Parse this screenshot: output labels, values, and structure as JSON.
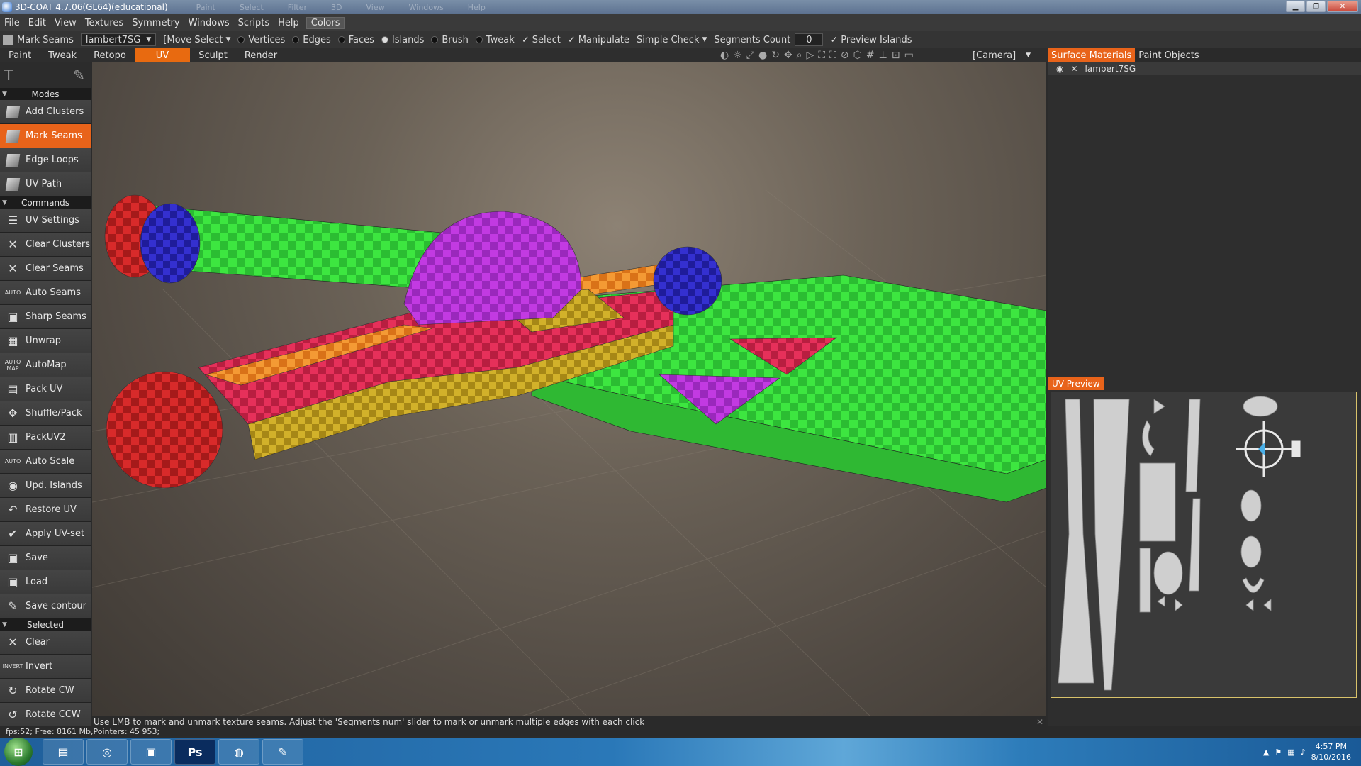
{
  "title": "3D-COAT 4.7.06(GL64)(educational)",
  "ghost_menu": [
    "Paint",
    "Select",
    "Filter",
    "3D",
    "View",
    "Windows",
    "Help"
  ],
  "menu": [
    "File",
    "Edit",
    "View",
    "Textures",
    "Symmetry",
    "Windows",
    "Scripts",
    "Help",
    "Colors"
  ],
  "options": {
    "tool_name": "Mark Seams",
    "material": "lambert7SG",
    "move_select": "[Move Select",
    "vertices": "Vertices",
    "edges": "Edges",
    "faces": "Faces",
    "islands": "Islands",
    "brush": "Brush",
    "tweak": "Tweak",
    "select": "Select",
    "manipulate": "Manipulate",
    "simple_check": "Simple Check",
    "segments_count": "Segments Count",
    "segments_value": "0",
    "preview_islands": "Preview Islands"
  },
  "rooms": [
    "Paint",
    "Tweak",
    "Retopo",
    "UV",
    "Sculpt",
    "Render"
  ],
  "active_room": "UV",
  "camera_label": "[Camera]",
  "sections": {
    "modes": "Modes",
    "commands": "Commands",
    "selected": "Selected"
  },
  "modes": [
    {
      "label": "Add Clusters",
      "icon": "cube-icon"
    },
    {
      "label": "Mark Seams",
      "icon": "cube-icon",
      "active": true
    },
    {
      "label": "Edge Loops",
      "icon": "cube-icon"
    },
    {
      "label": "UV Path",
      "icon": "cube-icon"
    }
  ],
  "commands": [
    {
      "label": "UV Settings",
      "icon": "sliders-icon",
      "glyph": "☰"
    },
    {
      "label": "Clear Clusters",
      "icon": "x-icon",
      "glyph": "✕"
    },
    {
      "label": "Clear Seams",
      "icon": "x-icon",
      "glyph": "✕"
    },
    {
      "label": "Auto Seams",
      "icon": "auto-icon",
      "glyph": "AUTO"
    },
    {
      "label": "Sharp Seams",
      "icon": "cube-icon",
      "glyph": "▣"
    },
    {
      "label": "Unwrap",
      "icon": "grid-icon",
      "glyph": "▦"
    },
    {
      "label": "AutoMap",
      "icon": "automap-icon",
      "glyph": "AUTO MAP"
    },
    {
      "label": "Pack UV",
      "icon": "pack-icon",
      "glyph": "▤"
    },
    {
      "label": "Shuffle/Pack",
      "icon": "shuffle-icon",
      "glyph": "✥"
    },
    {
      "label": "PackUV2",
      "icon": "pack-icon",
      "glyph": "▥"
    },
    {
      "label": "Auto Scale",
      "icon": "auto-scale-icon",
      "glyph": "AUTO"
    },
    {
      "label": "Upd. Islands",
      "icon": "update-icon",
      "glyph": "◉"
    },
    {
      "label": "Restore UV",
      "icon": "restore-icon",
      "glyph": "↶"
    },
    {
      "label": "Apply UV-set",
      "icon": "check-icon",
      "glyph": "✔"
    },
    {
      "label": "Save",
      "icon": "save-icon",
      "glyph": "▣"
    },
    {
      "label": "Load",
      "icon": "load-icon",
      "glyph": "▣"
    },
    {
      "label": "Save contour",
      "icon": "contour-icon",
      "glyph": "✎"
    }
  ],
  "selected": [
    {
      "label": "Clear",
      "icon": "x-icon",
      "glyph": "✕"
    },
    {
      "label": "Invert",
      "icon": "invert-icon",
      "glyph": "INVERT"
    },
    {
      "label": "Rotate CW",
      "icon": "rotate-cw-icon",
      "glyph": "↻"
    },
    {
      "label": "Rotate CCW",
      "icon": "rotate-ccw-icon",
      "glyph": "↺"
    }
  ],
  "right_tabs": [
    "Surface Materials",
    "Paint Objects"
  ],
  "layer_name": "lambert7SG",
  "uv_preview_label": "UV Preview",
  "hint": "Use LMB to mark and unmark texture seams. Adjust the 'Segments num' slider to mark or unmark multiple edges with each click",
  "status": "fps:52;    Free: 8161 Mb,Pointers: 45 953;",
  "taskbar": {
    "apps": [
      "explorer-icon",
      "chrome-icon",
      "monitor-icon",
      "photoshop-icon",
      "3dcoat-icon",
      "paint-icon"
    ],
    "ps_label": "Ps",
    "time": "4:57 PM",
    "date": "8/10/2016"
  },
  "colors": {
    "accent": "#e8631a",
    "green": "#39e03a",
    "magenta": "#b832d8",
    "red": "#d8283a",
    "blue": "#2d2ac8",
    "orange": "#f08a24",
    "yellow": "#c8a820"
  }
}
